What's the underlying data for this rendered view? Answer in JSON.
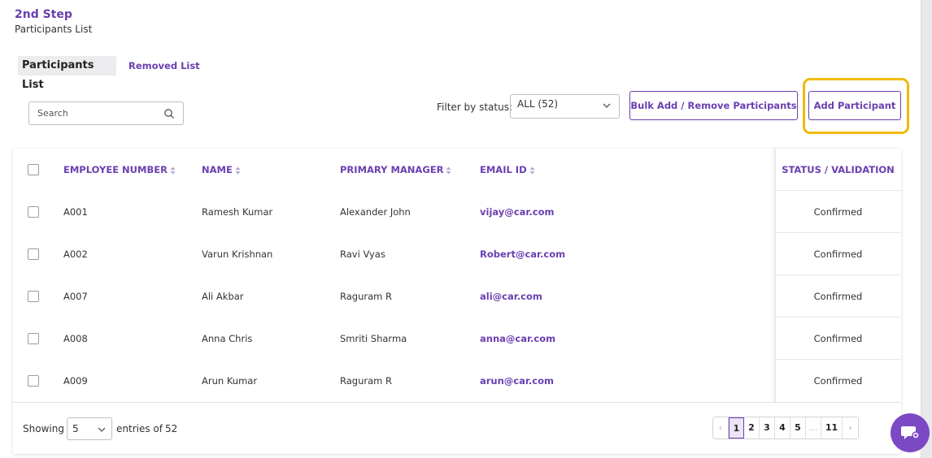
{
  "step": {
    "title": "2nd Step",
    "subtitle": "Participants List"
  },
  "tabs": [
    {
      "label": "Participants List",
      "active": true
    },
    {
      "label": "Removed List",
      "active": false
    }
  ],
  "search": {
    "placeholder": "Search"
  },
  "filter": {
    "label": "Filter by status:",
    "selected": "ALL (52)"
  },
  "buttons": {
    "bulk": "Bulk Add / Remove Participants",
    "add": "Add Participant"
  },
  "table": {
    "headers": {
      "employee_number": "EMPLOYEE NUMBER",
      "name": "NAME",
      "primary_manager": "PRIMARY MANAGER",
      "email": "EMAIL ID",
      "status": "STATUS / VALIDATION"
    },
    "rows": [
      {
        "employee_number": "A001",
        "name": "Ramesh Kumar",
        "manager": "Alexander John",
        "email": "vijay@car.com",
        "status": "Confirmed"
      },
      {
        "employee_number": "A002",
        "name": "Varun Krishnan",
        "manager": "Ravi Vyas",
        "email": "Robert@car.com",
        "status": "Confirmed"
      },
      {
        "employee_number": "A007",
        "name": "Ali Akbar",
        "manager": "Raguram R",
        "email": "ali@car.com",
        "status": "Confirmed"
      },
      {
        "employee_number": "A008",
        "name": "Anna Chris",
        "manager": "Smriti Sharma",
        "email": "anna@car.com",
        "status": "Confirmed"
      },
      {
        "employee_number": "A009",
        "name": "Arun Kumar",
        "manager": "Raguram R",
        "email": "arun@car.com",
        "status": "Confirmed"
      }
    ]
  },
  "footer": {
    "showing_label": "Showing",
    "page_size": "5",
    "entries_label": "entries of",
    "total": "52"
  },
  "pagination": {
    "prev": "‹",
    "pages": [
      "1",
      "2",
      "3",
      "4",
      "5",
      "...",
      "11"
    ],
    "next": "›",
    "current": "1"
  },
  "colors": {
    "accent": "#6a3fb0",
    "highlight": "#f1b90a",
    "chat": "#7b49c4"
  },
  "icons": {
    "search": "search-icon",
    "chat": "chat-icon",
    "sort": "sort-icon",
    "chevron": "chevron-down-icon"
  }
}
